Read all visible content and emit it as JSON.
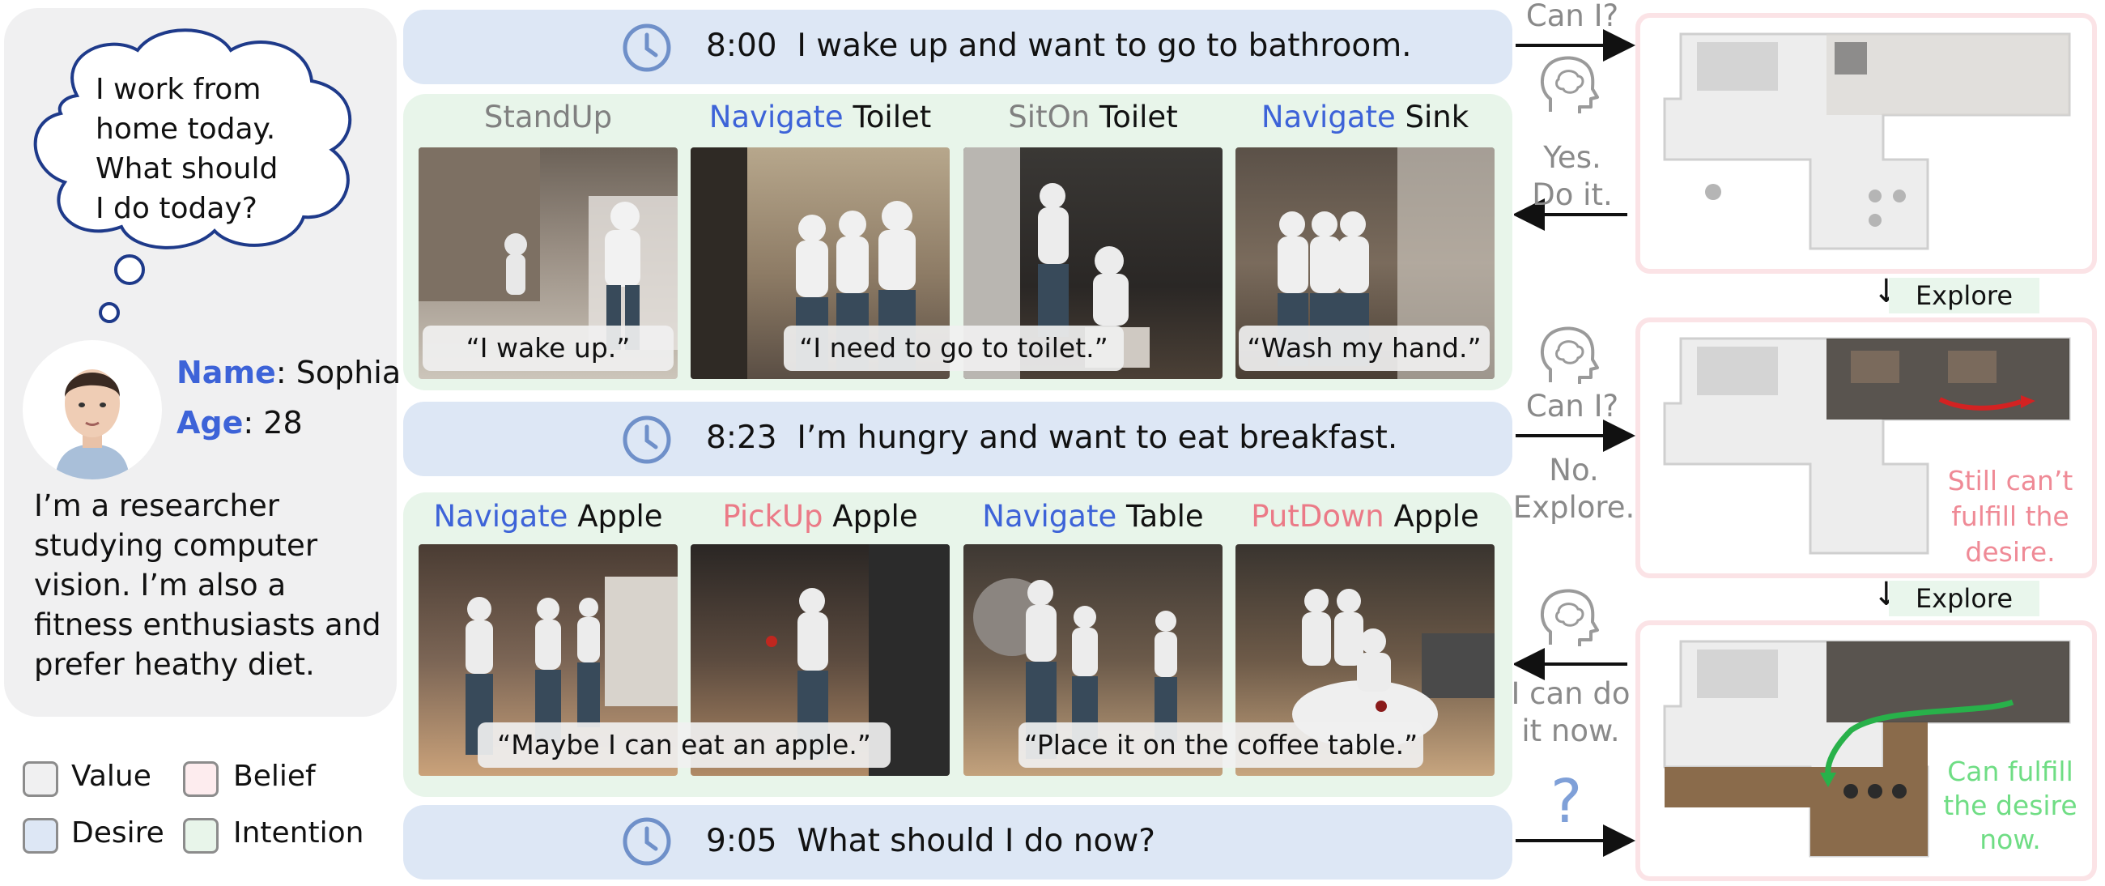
{
  "persona": {
    "thought": [
      "I work from",
      "home today.",
      "What should",
      "I do today?"
    ],
    "name_label": "Name",
    "name_value": ": Sophia",
    "age_label": "Age",
    "age_value": ": 28",
    "bio": [
      "I’m a researcher",
      "studying computer",
      "vision. I’m also a",
      "fitness enthusiasts and",
      "prefer heathy diet."
    ]
  },
  "legend": {
    "items": [
      {
        "label": "Value",
        "color": "#f0f0f1"
      },
      {
        "label": "Belief",
        "color": "#fdecee"
      },
      {
        "label": "Desire",
        "color": "#dde7f5"
      },
      {
        "label": "Intention",
        "color": "#e8f5ea"
      }
    ]
  },
  "timeline": [
    {
      "time": "8:00",
      "text": "I wake up and want to go to bathroom."
    },
    {
      "time": "8:23",
      "text": "I’m hungry and want to eat breakfast."
    },
    {
      "time": "9:05",
      "text": "What should I do now?"
    }
  ],
  "intentions": [
    {
      "actions": [
        {
          "verb": "StandUp",
          "object": ""
        },
        {
          "verb": "Navigate",
          "object": " Toilet"
        },
        {
          "verb": "SitOn",
          "object": " Toilet"
        },
        {
          "verb": "Navigate",
          "object": " Sink"
        }
      ],
      "captions": [
        "“I wake up.”",
        "“I need to go to toilet.”",
        "“Wash my hand.”"
      ]
    },
    {
      "actions": [
        {
          "verb": "Navigate",
          "object": " Apple"
        },
        {
          "verb": "PickUp",
          "object": " Apple"
        },
        {
          "verb": "Navigate",
          "object": " Table"
        },
        {
          "verb": "PutDown",
          "object": " Apple"
        }
      ],
      "captions": [
        "“Maybe I can eat an apple.”",
        "“Place it on the coffee table.”"
      ]
    }
  ],
  "dialog": {
    "q1": "Can I?",
    "a1": [
      "Yes.",
      "Do it."
    ],
    "q2": "Can I?",
    "a2": [
      "No.",
      "Explore."
    ],
    "a3": [
      "I can do",
      "it now."
    ],
    "q4": "?"
  },
  "maps": {
    "explore_label": "Explore",
    "explore_label_2": "Explore",
    "fail_text": [
      "Still can’t",
      "fulfill the",
      "desire."
    ],
    "success_text": [
      "Can fulfill",
      "the desire",
      "now."
    ]
  },
  "colors": {
    "navigate": "#3d63d8",
    "pickup": "#eb7a87",
    "standup": "#808080",
    "fail": "#ef8a96",
    "success": "#6fdd84"
  }
}
